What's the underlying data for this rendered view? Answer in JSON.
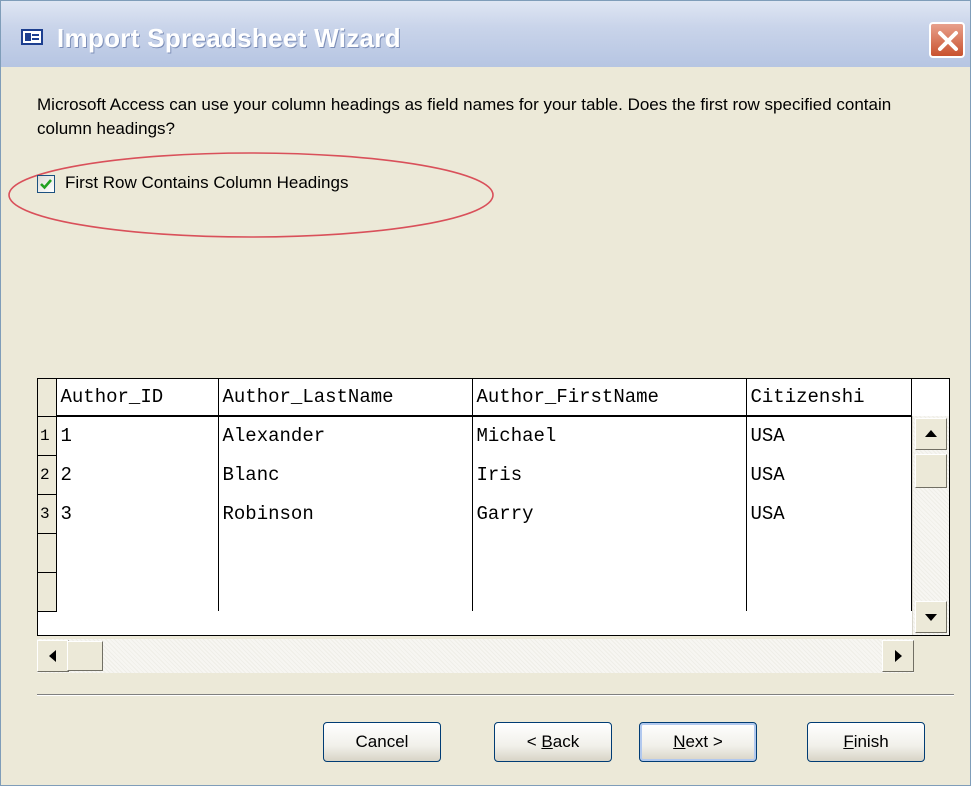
{
  "window": {
    "title": "Import Spreadsheet Wizard"
  },
  "description": "Microsoft Access can use your column headings as field names for your table. Does the first row specified contain column headings?",
  "checkbox": {
    "label": "First Row Contains Column Headings",
    "checked": true
  },
  "grid": {
    "columns": [
      "Author_ID",
      "Author_LastName",
      "Author_FirstName",
      "Citizenshi"
    ],
    "rows": [
      {
        "num": "1",
        "cells": [
          "1",
          "Alexander",
          "Michael",
          "USA"
        ]
      },
      {
        "num": "2",
        "cells": [
          "2",
          "Blanc",
          "Iris",
          "USA"
        ]
      },
      {
        "num": "3",
        "cells": [
          "3",
          "Robinson",
          "Garry",
          "USA"
        ]
      }
    ]
  },
  "buttons": {
    "cancel": "Cancel",
    "back_prefix": "< ",
    "back_mnemonic": "B",
    "back_rest": "ack",
    "next_mnemonic": "N",
    "next_rest": "ext >",
    "finish_mnemonic": "F",
    "finish_rest": "inish"
  },
  "colors": {
    "titlebar": "#c9d4ea",
    "close_button": "#c9522f",
    "highlight_ellipse": "#d9505a",
    "checkmark": "#21a121"
  },
  "icons": [
    "app-icon",
    "close-icon",
    "checkmark-icon",
    "scroll-up-icon",
    "scroll-down-icon",
    "scroll-left-icon",
    "scroll-right-icon"
  ]
}
